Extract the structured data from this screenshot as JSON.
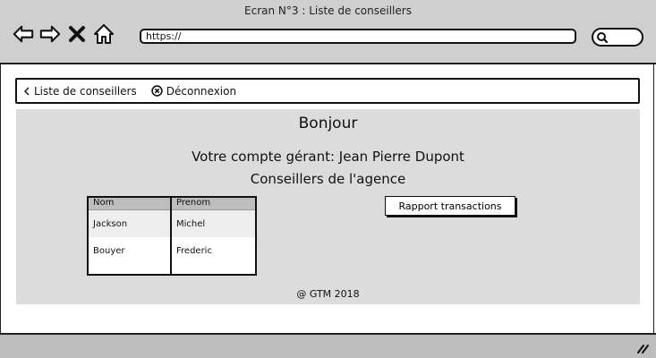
{
  "window": {
    "title": "Ecran N°3 : Liste de conseillers"
  },
  "browser": {
    "url": "https://",
    "icons": [
      "back-arrow-icon",
      "forward-arrow-icon",
      "close-x-icon",
      "home-icon",
      "search-icon"
    ]
  },
  "menu": {
    "back_label": "Liste de conseillers",
    "logout_label": "Déconnexion"
  },
  "page": {
    "greeting": "Bonjour",
    "account": "Votre compte gérant: Jean Pierre Dupont",
    "section_title": "Conseillers de l'agence",
    "report_button": "Rapport transactions",
    "footer": "@ GTM 2018"
  },
  "table": {
    "columns": [
      "Nom",
      "Prenom"
    ],
    "rows": [
      [
        "Jackson",
        "Michel"
      ],
      [
        "Bouyer",
        "Frederic"
      ]
    ]
  }
}
